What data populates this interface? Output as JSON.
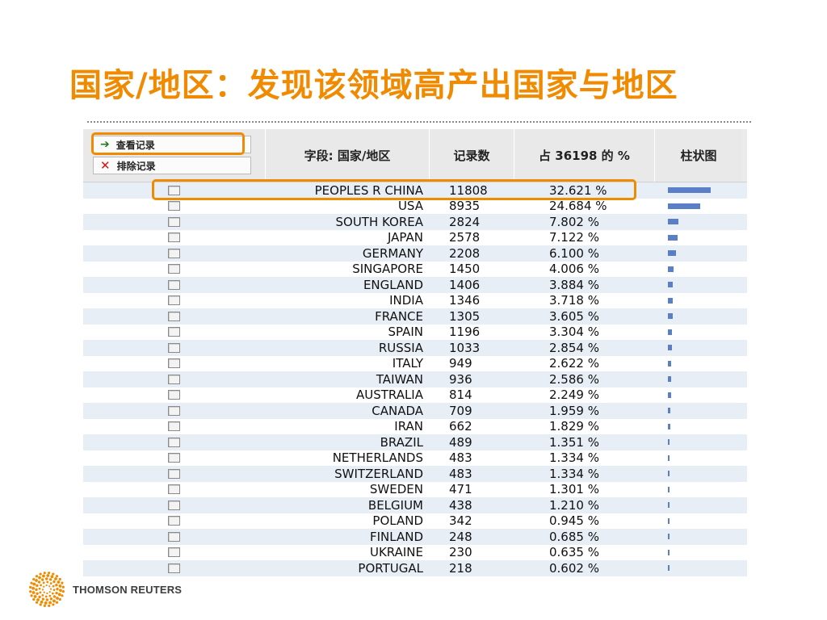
{
  "slide": {
    "title": "国家/地区：发现该领域高产出国家与地区"
  },
  "actions": {
    "view_records": "查看记录",
    "exclude_records": "排除记录"
  },
  "table": {
    "headers": [
      "字段: 国家/地区",
      "记录数",
      "占 36198 的 %",
      "柱状图"
    ],
    "total": 36198,
    "rows": [
      {
        "country": "PEOPLES R CHINA",
        "count": "11808",
        "percent": "32.621 %"
      },
      {
        "country": "USA",
        "count": "8935",
        "percent": "24.684 %"
      },
      {
        "country": "SOUTH KOREA",
        "count": "2824",
        "percent": "7.802 %"
      },
      {
        "country": "JAPAN",
        "count": "2578",
        "percent": "7.122 %"
      },
      {
        "country": "GERMANY",
        "count": "2208",
        "percent": "6.100 %"
      },
      {
        "country": "SINGAPORE",
        "count": "1450",
        "percent": "4.006 %"
      },
      {
        "country": "ENGLAND",
        "count": "1406",
        "percent": "3.884 %"
      },
      {
        "country": "INDIA",
        "count": "1346",
        "percent": "3.718 %"
      },
      {
        "country": "FRANCE",
        "count": "1305",
        "percent": "3.605 %"
      },
      {
        "country": "SPAIN",
        "count": "1196",
        "percent": "3.304 %"
      },
      {
        "country": "RUSSIA",
        "count": "1033",
        "percent": "2.854 %"
      },
      {
        "country": "ITALY",
        "count": "949",
        "percent": "2.622 %"
      },
      {
        "country": "TAIWAN",
        "count": "936",
        "percent": "2.586 %"
      },
      {
        "country": "AUSTRALIA",
        "count": "814",
        "percent": "2.249 %"
      },
      {
        "country": "CANADA",
        "count": "709",
        "percent": "1.959 %"
      },
      {
        "country": "IRAN",
        "count": "662",
        "percent": "1.829 %"
      },
      {
        "country": "BRAZIL",
        "count": "489",
        "percent": "1.351 %"
      },
      {
        "country": "NETHERLANDS",
        "count": "483",
        "percent": "1.334 %"
      },
      {
        "country": "SWITZERLAND",
        "count": "483",
        "percent": "1.334 %"
      },
      {
        "country": "SWEDEN",
        "count": "471",
        "percent": "1.301 %"
      },
      {
        "country": "BELGIUM",
        "count": "438",
        "percent": "1.210 %"
      },
      {
        "country": "POLAND",
        "count": "342",
        "percent": "0.945 %"
      },
      {
        "country": "FINLAND",
        "count": "248",
        "percent": "0.685 %"
      },
      {
        "country": "UKRAINE",
        "count": "230",
        "percent": "0.635 %"
      },
      {
        "country": "PORTUGAL",
        "count": "218",
        "percent": "0.602 %"
      }
    ]
  },
  "colors": {
    "accent": "#f08a00",
    "bar": "#5b7fc6",
    "row_alt": "#e8eef6"
  },
  "footer": {
    "logo_text": "THOMSON REUTERS",
    "logo_icon": "thomson-reuters-dot-sphere-icon"
  }
}
